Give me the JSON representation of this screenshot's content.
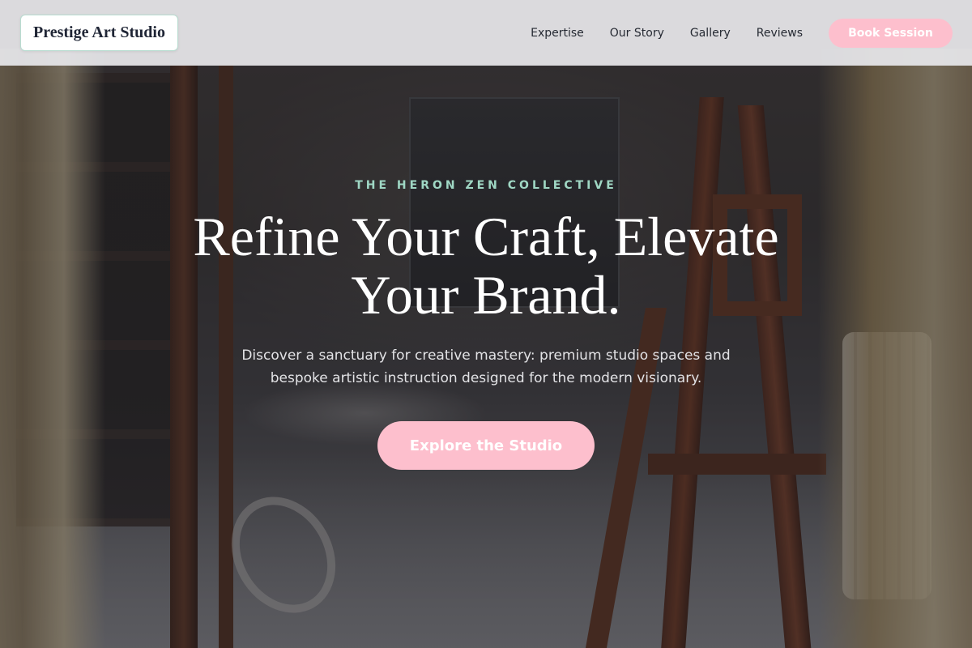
{
  "header": {
    "logo": "Prestige Art Studio",
    "nav": [
      {
        "label": "Expertise"
      },
      {
        "label": "Our Story"
      },
      {
        "label": "Gallery"
      },
      {
        "label": "Reviews"
      }
    ],
    "cta_label": "Book Session"
  },
  "hero": {
    "eyebrow": "THE HERON ZEN COLLECTIVE",
    "headline": "Refine Your Craft, Elevate Your Brand.",
    "subtext": "Discover a sanctuary for creative mastery: premium studio spaces and bespoke artistic instruction designed for the modern visionary.",
    "cta_label": "Explore the Studio"
  },
  "colors": {
    "accent_pink": "#fdbfcd",
    "accent_mint": "#9fd7c4",
    "header_bg": "#e6e6e9",
    "text_dark": "#1f2535"
  }
}
